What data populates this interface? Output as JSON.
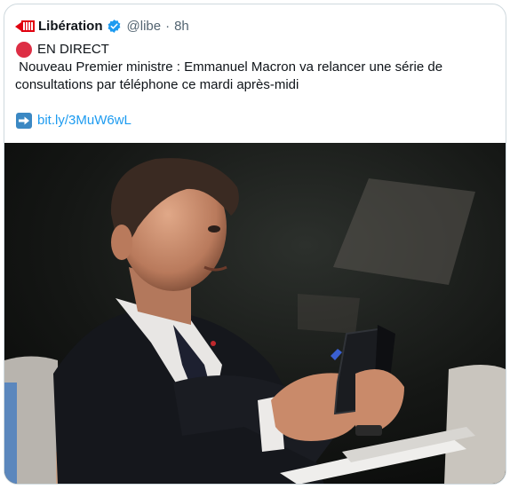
{
  "tweet": {
    "author_name": "Libération",
    "handle": "@libe",
    "separator": "·",
    "time": "8h",
    "live_label": "EN DIRECT",
    "text": " Nouveau Premier ministre : Emmanuel Macron va relancer une série de consultations par téléphone ce mardi après-midi",
    "link": "bit.ly/3MuW6wL",
    "icons": {
      "logo": "liberation-logo-icon",
      "verified": "verified-badge-icon",
      "live": "red-circle-icon",
      "arrow": "right-arrow-icon"
    },
    "colors": {
      "verified": "#1d9bf0",
      "live_dot": "#dd2e44",
      "link": "#1d9bf0",
      "logo_red": "#e1000f"
    }
  },
  "media": {
    "icon": "photo-man-with-phone"
  }
}
